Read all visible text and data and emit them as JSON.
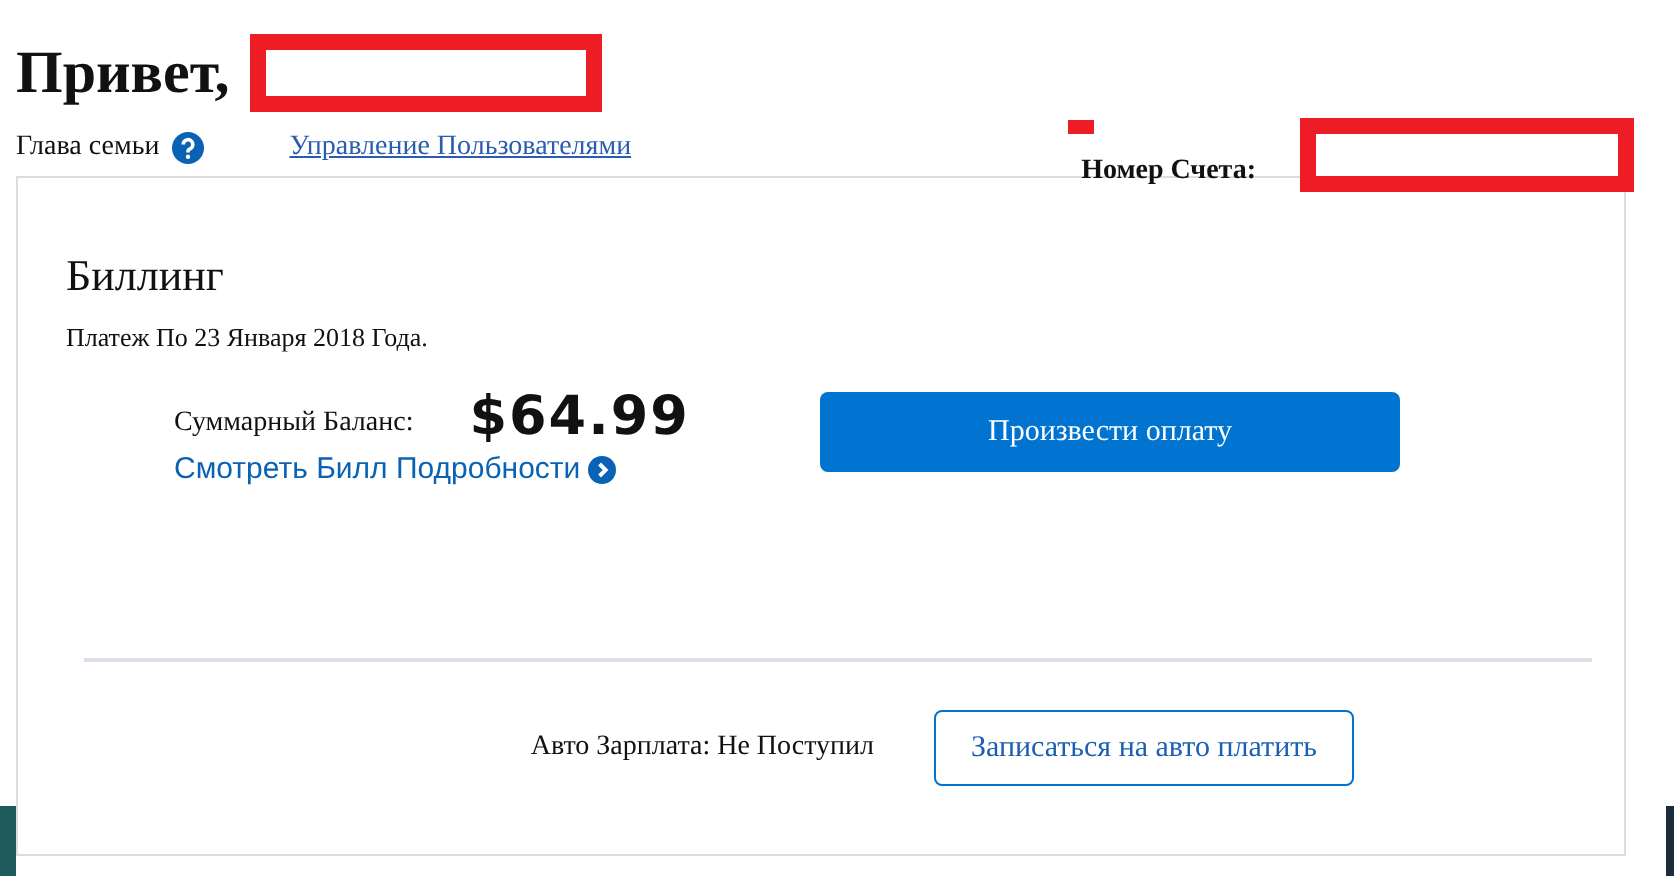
{
  "greeting": "Привет,",
  "role": {
    "label": "Глава семьи"
  },
  "manage_users_link": "Управление Пользователями",
  "account": {
    "label": "Номер Счета:"
  },
  "billing": {
    "title": "Биллинг",
    "due_text": "Платеж По 23 Января 2018 Года.",
    "balance_label": "Суммарный Баланс:",
    "balance": "$64.99",
    "details_link": "Смотреть Билл Подробности",
    "pay_button": "Произвести оплату",
    "autopay_status": "Авто Зарплата: Не Поступил",
    "autopay_button": "Записаться на авто платить"
  }
}
